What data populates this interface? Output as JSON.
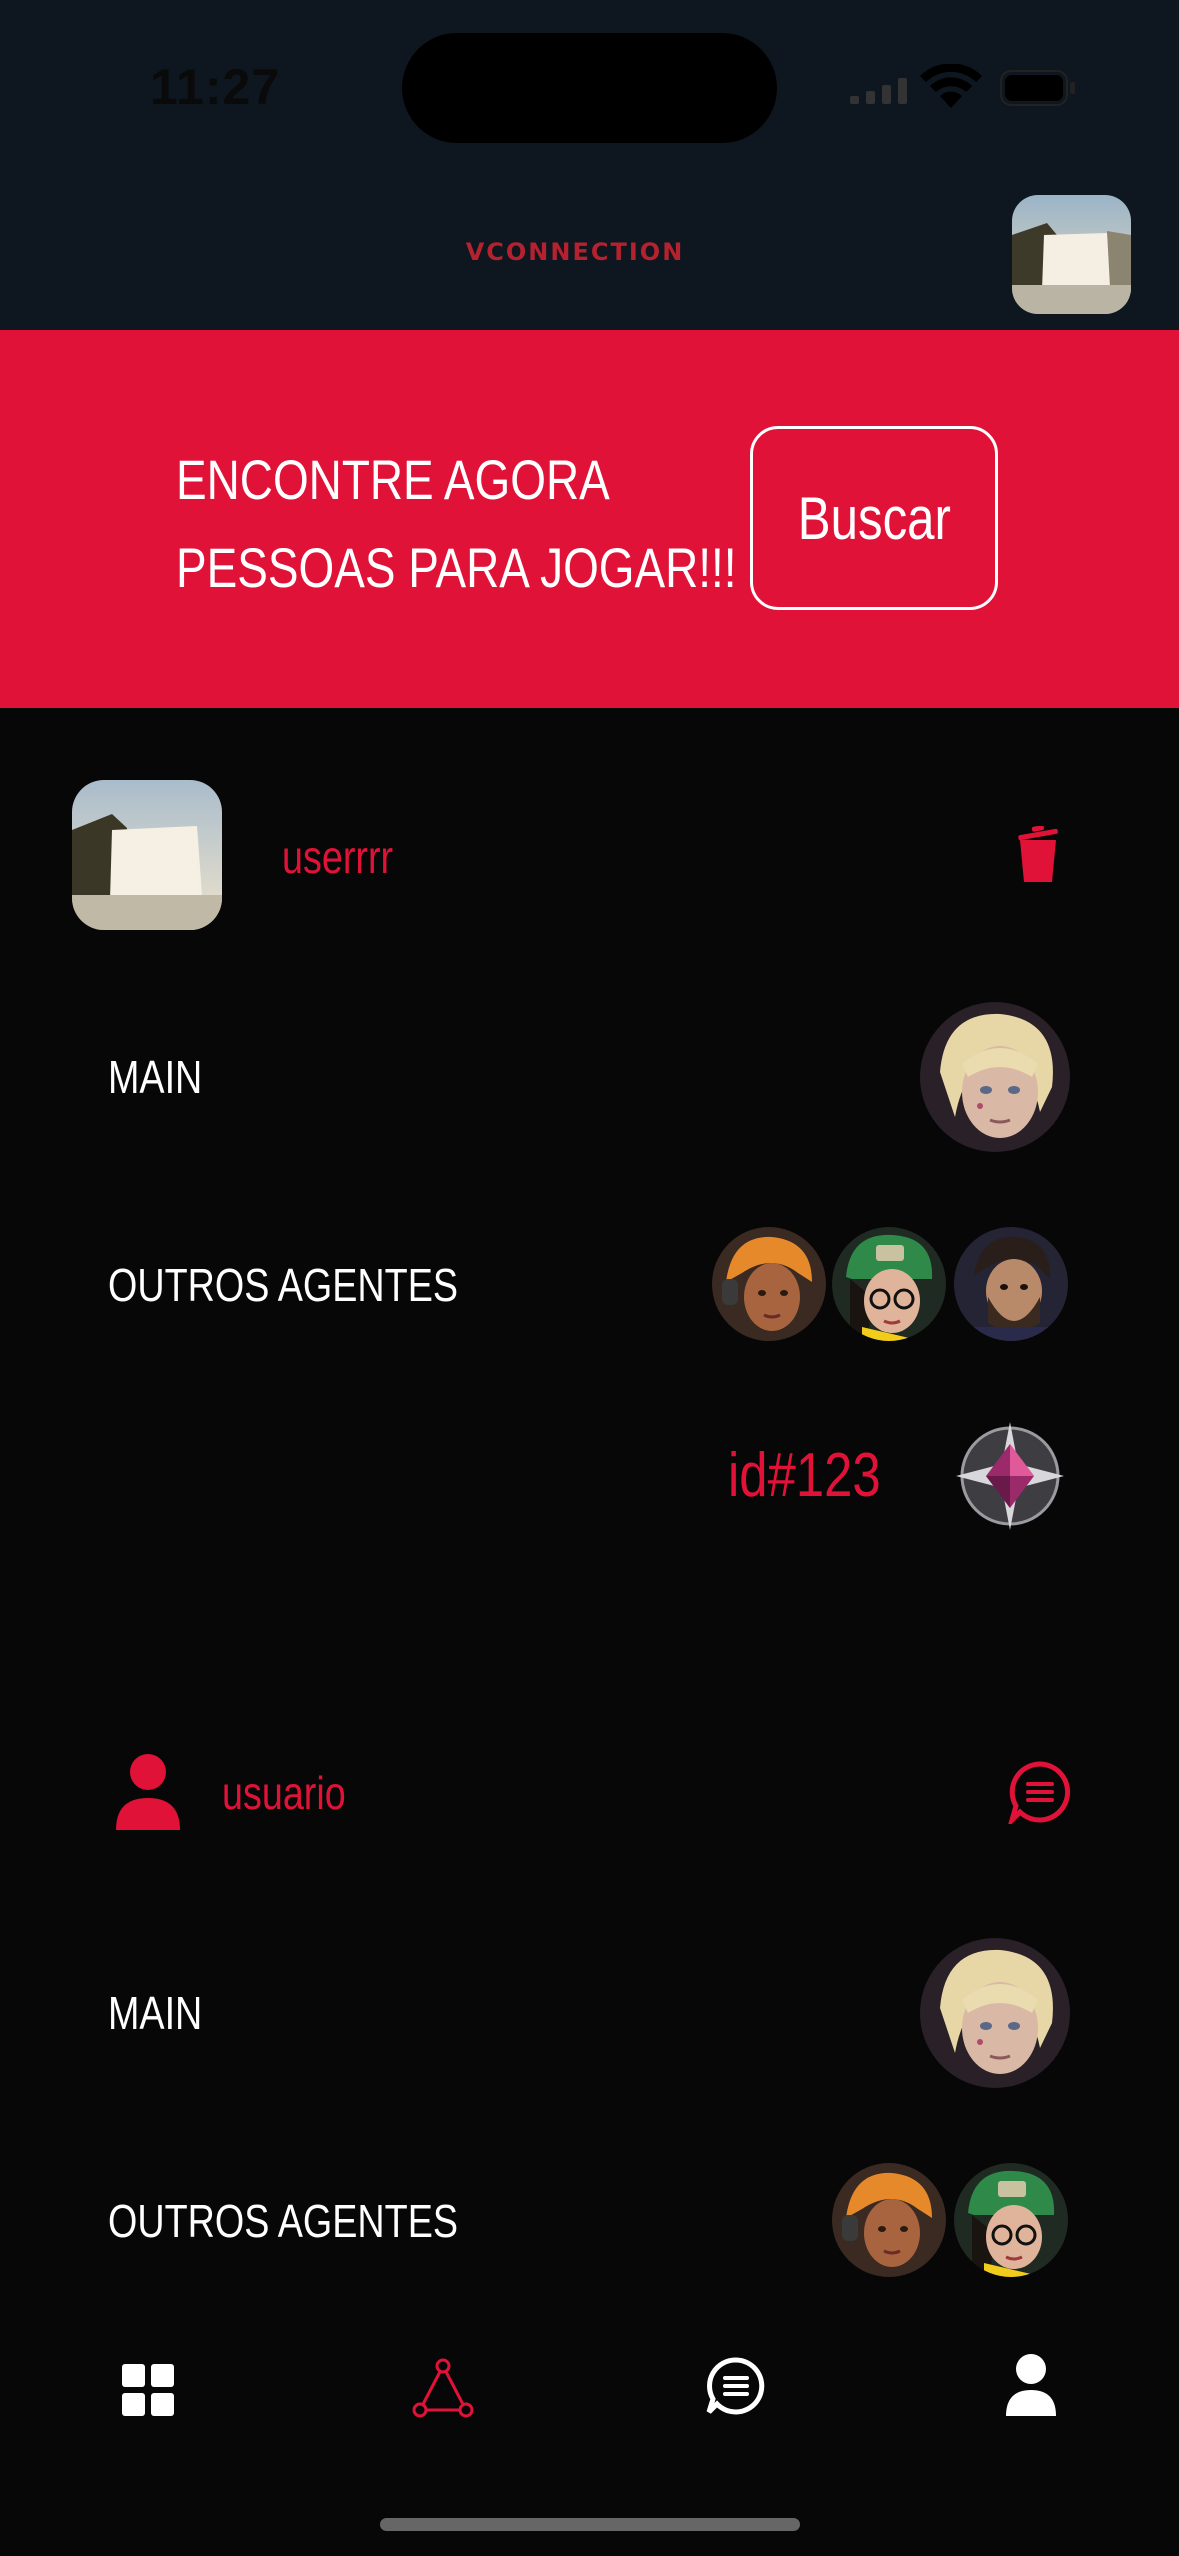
{
  "status_bar": {
    "time": "11:27"
  },
  "header": {
    "logo": "VCONNECTION"
  },
  "banner": {
    "line1": "ENCONTRE AGORA",
    "line2": "PESSOAS PARA JOGAR!!!",
    "button_label": "Buscar"
  },
  "cards": [
    {
      "username": "userrrr",
      "main_label": "MAIN",
      "others_label": "OUTROS AGENTES",
      "player_id": "id#123",
      "action_icon": "trash-icon"
    },
    {
      "username": "usuario",
      "main_label": "MAIN",
      "others_label": "OUTROS AGENTES",
      "action_icon": "chat-icon"
    }
  ],
  "tabbar": {
    "tabs": [
      "grid-icon",
      "network-icon",
      "chat-icon",
      "profile-icon"
    ],
    "active_index": 1
  },
  "colors": {
    "accent": "#e11238",
    "header_bg": "#0e1620",
    "page_bg": "#070708"
  }
}
